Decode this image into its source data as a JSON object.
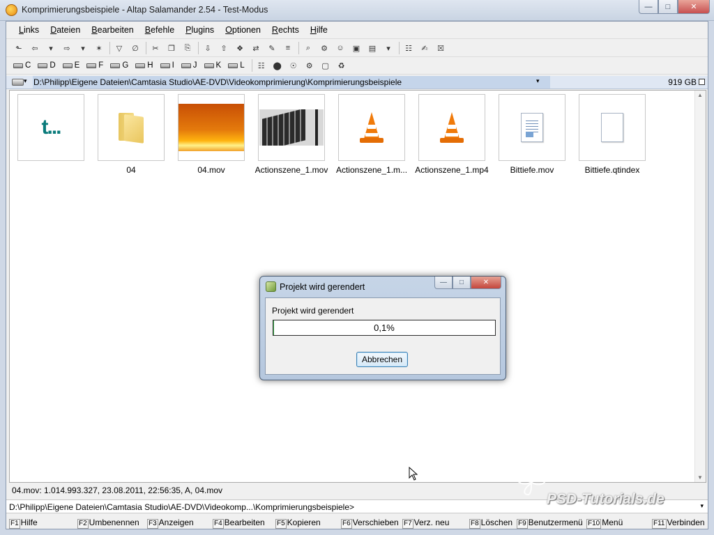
{
  "window": {
    "title": "Komprimierungsbeispiele - Altap Salamander 2.54 - Test-Modus",
    "min_glyph": "—",
    "max_glyph": "□",
    "close_glyph": "✕"
  },
  "menu": [
    "Links",
    "Dateien",
    "Bearbeiten",
    "Befehle",
    "Plugins",
    "Optionen",
    "Rechts",
    "Hilfe"
  ],
  "drives": [
    "C",
    "D",
    "E",
    "F",
    "G",
    "H",
    "I",
    "J",
    "K",
    "L"
  ],
  "path": {
    "current": "D:\\Philipp\\Eigene Dateien\\Camtasia Studio\\AE-DVD\\Videokomprimierung\\Komprimierungsbeispiele",
    "free_space": "919 GB",
    "dropdown_glyph": "▾"
  },
  "files": [
    {
      "name": "",
      "kind": "updir",
      "glyph": "t..."
    },
    {
      "name": "04",
      "kind": "folder"
    },
    {
      "name": "04.mov",
      "kind": "video-thumb-fire"
    },
    {
      "name": "Actionszene_1.mov",
      "kind": "video-thumb-building"
    },
    {
      "name": "Actionszene_1.m...",
      "kind": "vlc"
    },
    {
      "name": "Actionszene_1.mp4",
      "kind": "vlc"
    },
    {
      "name": "Bittiefe.mov",
      "kind": "document"
    },
    {
      "name": "Bittiefe.qtindex",
      "kind": "blank-document"
    }
  ],
  "status": {
    "info": "04.mov: 1.014.993.327, 23.08.2011, 22:56:35, A, 04.mov",
    "command_line": "D:\\Philipp\\Eigene Dateien\\Camtasia Studio\\AE-DVD\\Videokomp...\\Komprimierungsbeispiele>"
  },
  "fkeys": [
    {
      "key": "F1",
      "label": "Hilfe"
    },
    {
      "key": "F2",
      "label": "Umbenennen"
    },
    {
      "key": "F3",
      "label": "Anzeigen"
    },
    {
      "key": "F4",
      "label": "Bearbeiten"
    },
    {
      "key": "F5",
      "label": "Kopieren"
    },
    {
      "key": "F6",
      "label": "Verschieben"
    },
    {
      "key": "F7",
      "label": "Verz. neu"
    },
    {
      "key": "F8",
      "label": "Löschen"
    },
    {
      "key": "F9",
      "label": "Benutzermenü"
    },
    {
      "key": "F10",
      "label": "Menü"
    },
    {
      "key": "F11",
      "label": "Verbinden"
    }
  ],
  "dialog": {
    "title": "Projekt wird gerendert",
    "message": "Projekt wird gerendert",
    "progress": 0.001,
    "progress_text": "0,1%",
    "cancel_label": "Abbrechen"
  },
  "watermark": "PSD-Tutorials.de",
  "colors": {
    "progress_fill": "#36a845",
    "path_highlight": "#c5d5ea",
    "close_button": "#c75050"
  }
}
